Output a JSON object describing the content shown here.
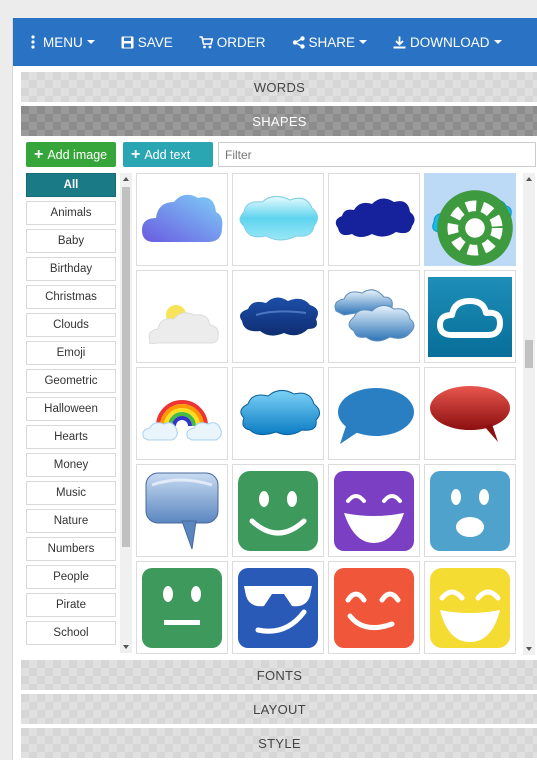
{
  "nav": {
    "menu": "MENU",
    "save": "SAVE",
    "order": "ORDER",
    "share": "SHARE",
    "download": "DOWNLOAD"
  },
  "sections": {
    "words": "WORDS",
    "shapes": "SHAPES",
    "fonts": "FONTS",
    "layout": "LAYOUT",
    "style": "STYLE"
  },
  "toolbar": {
    "add_image": "Add image",
    "add_text": "Add text",
    "filter_placeholder": "Filter",
    "filter_value": ""
  },
  "categories": [
    "All",
    "Animals",
    "Baby",
    "Birthday",
    "Christmas",
    "Clouds",
    "Emoji",
    "Geometric",
    "Halloween",
    "Hearts",
    "Money",
    "Music",
    "Nature",
    "Numbers",
    "People",
    "Pirate",
    "School"
  ],
  "selected_category": "All",
  "shapes": [
    "cloud-purple-gradient-icon",
    "cloud-aqua-icon",
    "cloud-navy-icon",
    "cloud-cluster-cyan-icon",
    "sun-cloud-icon",
    "cloud-dark-blue-icon",
    "cloud-pair-blue-icon",
    "cloud-tile-teal-icon",
    "rainbow-cloud-icon",
    "cloud-bubble-blue-icon",
    "speech-bubble-blue-icon",
    "speech-bubble-red-icon",
    "speech-bubble-glass-icon",
    "smiley-green-icon",
    "smiley-purple-icon",
    "surprised-blue-icon",
    "neutral-green-icon",
    "sunglasses-blue-icon",
    "wink-orange-icon",
    "laughing-yellow-icon"
  ],
  "selected_shape_index": 3,
  "colors": {
    "topbar": "#2a73c4",
    "add_image": "#37a63a",
    "add_text": "#2aa6b3",
    "category_active": "#1a7a86",
    "tile_selected": "#bcd9f5"
  }
}
